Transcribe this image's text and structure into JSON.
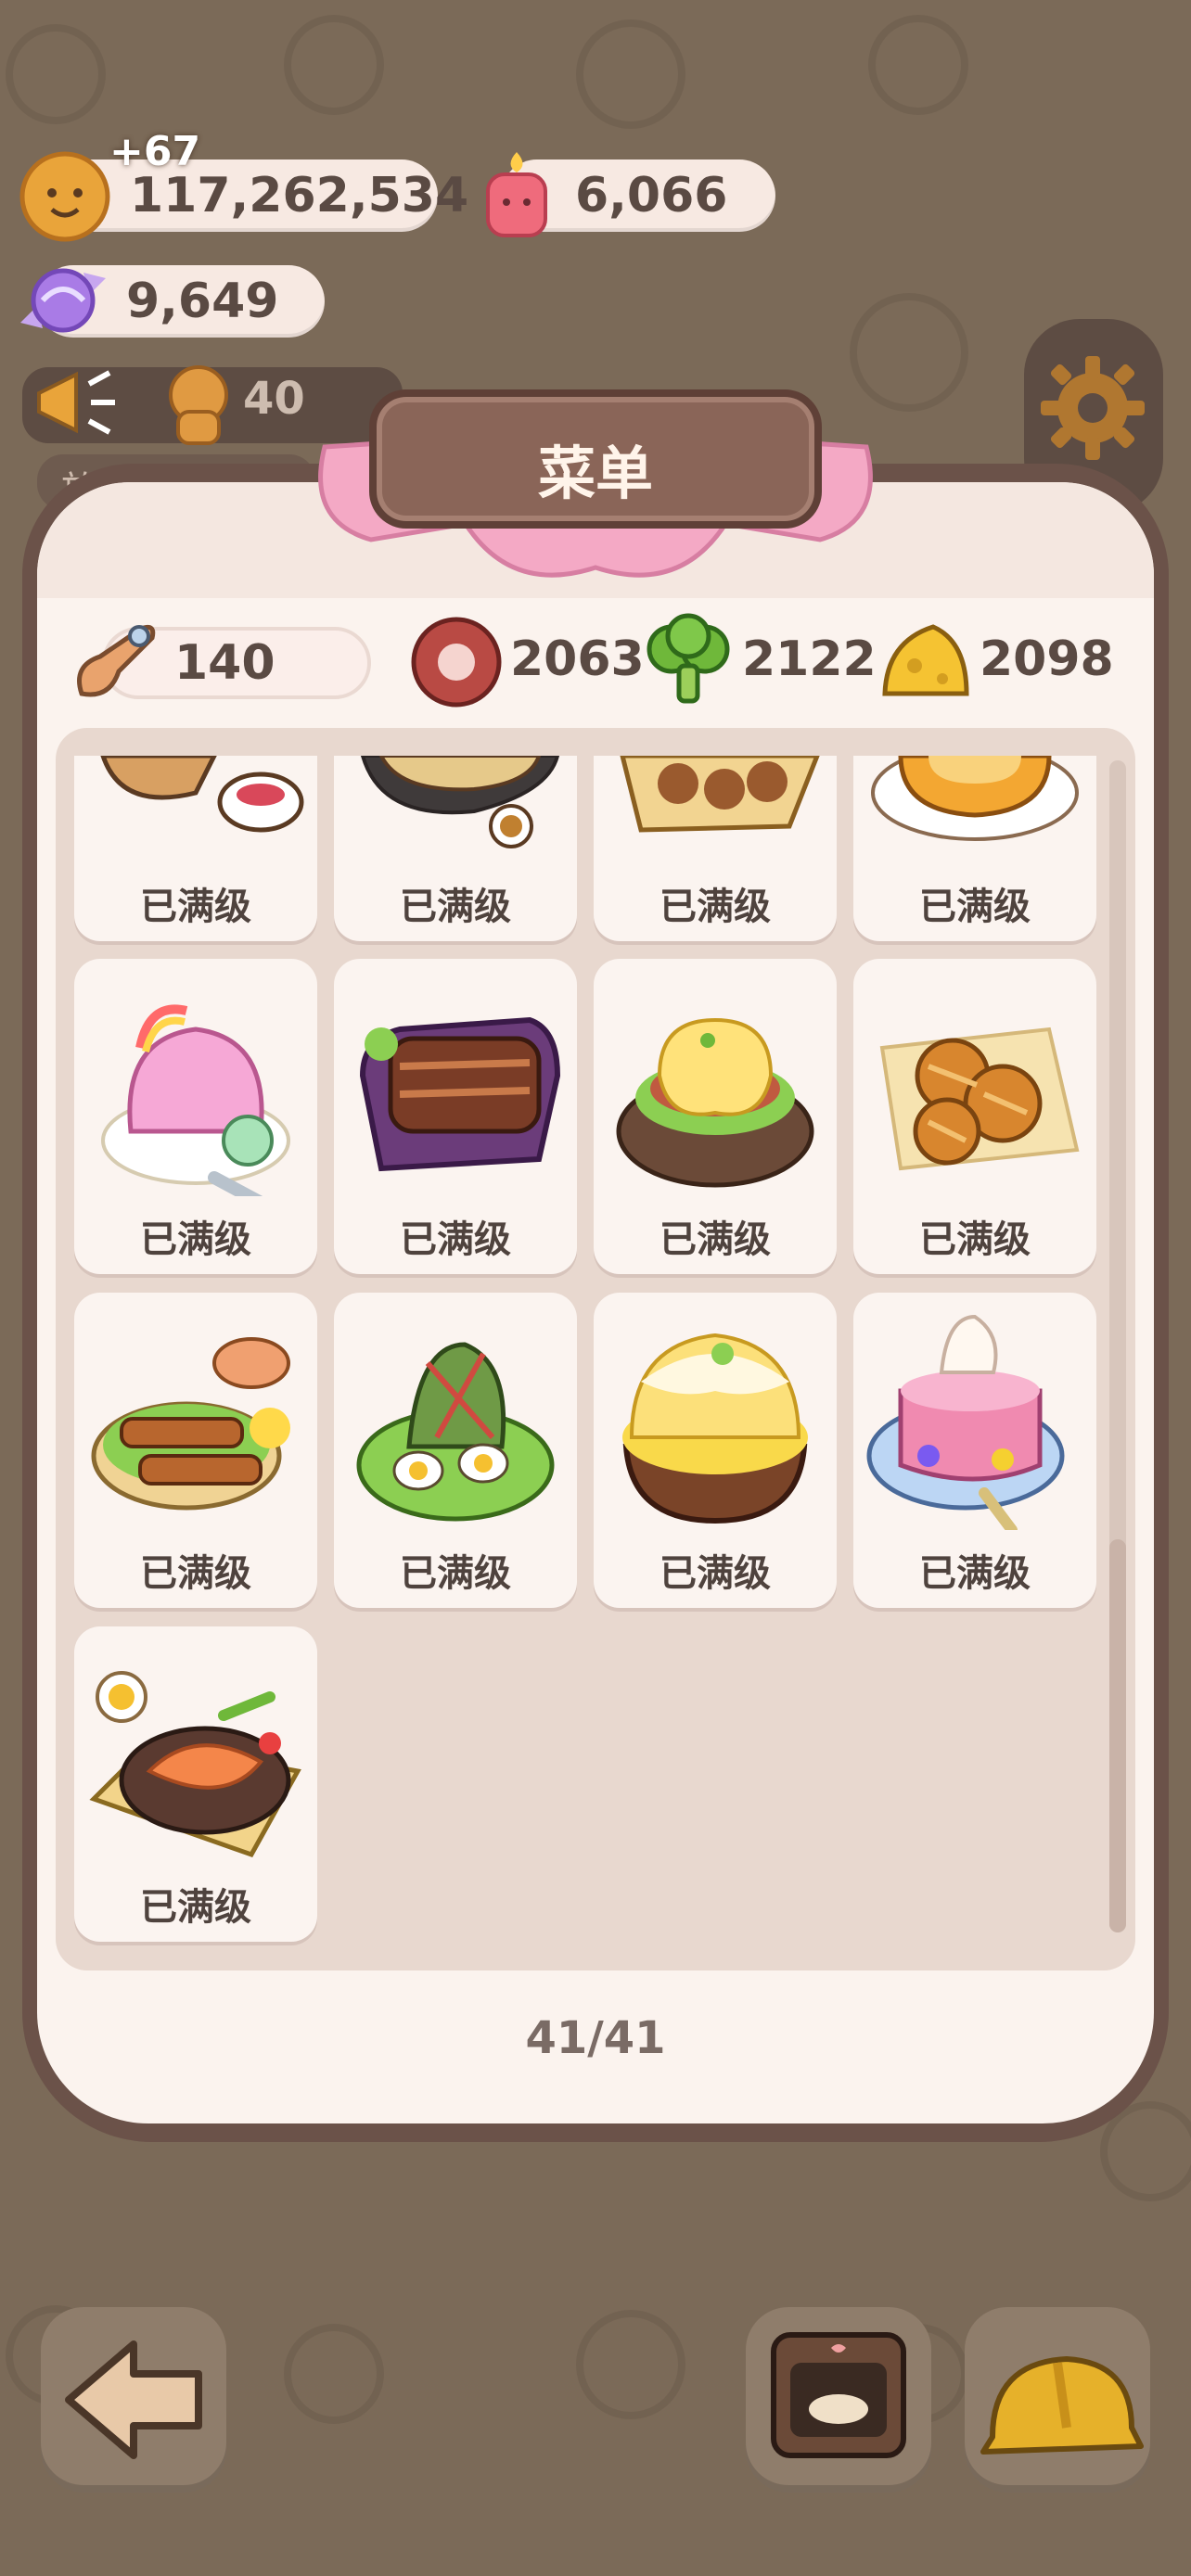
{
  "hud": {
    "cookie_gain": "+67",
    "cookie_count": "117,262,534",
    "candle_count": "6,066",
    "candy_count": "9,649",
    "visitor_count": "40",
    "side_text": "放映"
  },
  "menu": {
    "title": "菜单",
    "resources": [
      {
        "icon": "spoon-icon",
        "value": "140"
      },
      {
        "icon": "meat-icon",
        "value": "2063"
      },
      {
        "icon": "broccoli-icon",
        "value": "2122"
      },
      {
        "icon": "cheese-icon",
        "value": "2098"
      }
    ],
    "dishes": [
      {
        "icon": "toast-tea-dish-icon",
        "status": "已满级"
      },
      {
        "icon": "dumpling-dish-icon",
        "status": "已满级"
      },
      {
        "icon": "takoyaki-dish-icon",
        "status": "已满级"
      },
      {
        "icon": "pudding-dish-icon",
        "status": "已满级"
      },
      {
        "icon": "rainbow-icecream-dish-icon",
        "status": "已满级"
      },
      {
        "icon": "braised-pork-dish-icon",
        "status": "已满级"
      },
      {
        "icon": "eggs-benedict-dish-icon",
        "status": "已满级"
      },
      {
        "icon": "lattice-pie-dish-icon",
        "status": "已满级"
      },
      {
        "icon": "skewers-dish-icon",
        "status": "已满级"
      },
      {
        "icon": "zongzi-dish-icon",
        "status": "已满级"
      },
      {
        "icon": "mango-shaved-ice-dish-icon",
        "status": "已满级"
      },
      {
        "icon": "jelly-parfait-dish-icon",
        "status": "已满级"
      },
      {
        "icon": "salmon-platter-dish-icon",
        "status": "已满级"
      }
    ],
    "page_count": "41/41"
  },
  "colors": {
    "background": "#7b6a58",
    "panel": "#fbf3ee",
    "ribbon": "#f2a9c4",
    "title_plate": "#8a6558"
  }
}
